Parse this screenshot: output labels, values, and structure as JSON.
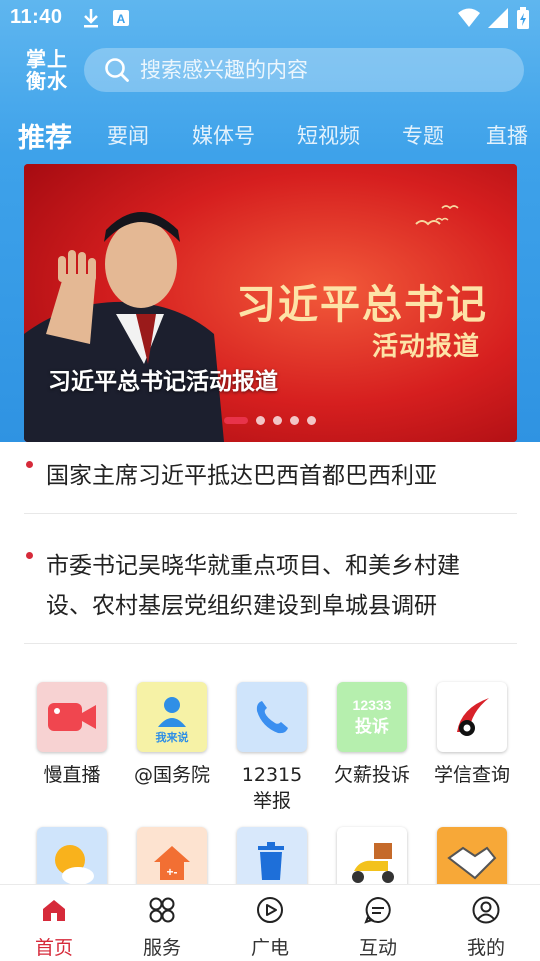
{
  "status_bar": {
    "time": "11:40",
    "icons": [
      "download-icon",
      "a-icon",
      "wifi-icon",
      "signal-icon",
      "battery-icon"
    ]
  },
  "header": {
    "logo_line1": "掌上",
    "logo_line2": "衡水",
    "search_placeholder": "搜索感兴趣的内容"
  },
  "tabs": [
    {
      "label": "推荐",
      "active": true
    },
    {
      "label": "要闻"
    },
    {
      "label": "媒体号"
    },
    {
      "label": "短视频"
    },
    {
      "label": "专题"
    },
    {
      "label": "直播"
    }
  ],
  "banner": {
    "caption": "习近平总书记活动报道",
    "headline_line1": "习近平总书记",
    "headline_line2": "活动报道",
    "slide_count": 5,
    "active_slide": 1
  },
  "news": [
    {
      "title_lines": [
        "国家主席习近平抵达巴西首都巴西利亚"
      ]
    },
    {
      "title_lines": [
        "市委书记吴晓华就重点项目、和美乡村建",
        "设、农村基层党组织建设到阜城县调研"
      ]
    }
  ],
  "services": [
    {
      "label": "慢直播",
      "icon": "video-camera-icon",
      "bg": "#f5d0d0"
    },
    {
      "label": "@国务院",
      "icon": "person-speak-icon",
      "bg": "#f4f0a8",
      "icon_text": "我来说"
    },
    {
      "label": "12315 举报",
      "label_line1": "12315",
      "label_line2": "举报",
      "icon": "phone-icon",
      "bg": "#cfe4fb"
    },
    {
      "label": "欠薪投诉",
      "icon": "complaint-icon",
      "bg": "#b8f0b0",
      "icon_text_line1": "12333",
      "icon_text_line2": "投诉"
    },
    {
      "label": "学信查询",
      "icon": "chsi-logo-icon",
      "bg": "#ffffff"
    },
    {
      "label": "",
      "icon": "weather-icon",
      "bg": "#cfe4fb"
    },
    {
      "label": "",
      "icon": "house-calculator-icon",
      "bg": "#fde3d0"
    },
    {
      "label": "",
      "icon": "trash-sort-icon",
      "bg": "#d8e8fb"
    },
    {
      "label": "",
      "icon": "scooter-delivery-icon",
      "bg": "#ffffff"
    },
    {
      "label": "",
      "icon": "handshake-icon",
      "bg": "#f7a838"
    }
  ],
  "bottom_nav": [
    {
      "label": "首页",
      "icon": "home-icon",
      "active": true
    },
    {
      "label": "服务",
      "icon": "services-grid-icon"
    },
    {
      "label": "广电",
      "icon": "play-circle-icon"
    },
    {
      "label": "互动",
      "icon": "chat-bubble-icon"
    },
    {
      "label": "我的",
      "icon": "user-circle-icon"
    }
  ],
  "colors": {
    "accent": "#d62a3a",
    "header_blue": "#3ea2ea",
    "banner_red": "#c8141a"
  }
}
